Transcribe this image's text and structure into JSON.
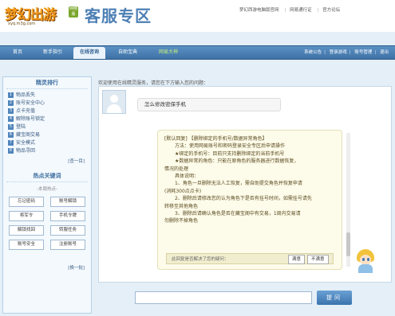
{
  "header": {
    "logo_text": "梦幻出游",
    "logo_tag": "网络版",
    "logo_url": "xyq.m3g.com",
    "title": "客服专区",
    "links": [
      "梦幻西游电脑版官网",
      "网易通行证",
      "官方论坛"
    ]
  },
  "nav": {
    "items": [
      {
        "label": "首页",
        "active": false
      },
      {
        "label": "新手指引",
        "active": false
      },
      {
        "label": "在线咨询",
        "active": true
      },
      {
        "label": "自助宝典",
        "active": false
      },
      {
        "label": "网易大神",
        "active": false
      }
    ],
    "right_links": [
      "系统公告",
      "登录游戏",
      "账号管理",
      "退出"
    ]
  },
  "sidebar": {
    "rank_title": "精灵排行",
    "rank_items": [
      "物品丢失",
      "账号安全中心",
      "点卡充值",
      "解除账号锁定",
      "登陆",
      "藏宝阁交易",
      "安全模式",
      "物品寻回"
    ],
    "rank_more": "[查一目]",
    "keyword_title": "热点关键词",
    "keyword_sub": "-本周热点-",
    "keywords": [
      "忘记密码",
      "账号解锁",
      "将军令",
      "手机令牌",
      "解锁找回",
      "转服任务",
      "账号安全",
      "注册账号"
    ],
    "keyword_more": "[换一批]"
  },
  "chat": {
    "hint": "欢迎使用在线精灵服务，请您在下方输入您的问题：",
    "question": "怎么修改密保手机",
    "answer": {
      "lines": [
        "[默认回复] 【删除绑定的手机号/数据异常角色】",
        "方法：使用网易账号和密码登录安全专区后申请操作",
        "★绑定的手机号：目前只支持删除绑定的当前手机号",
        "★数据异常的角色：只能在原角色的服务器进行数据恢复，",
        "情况的处理",
        "具体说明：",
        "1、角色一旦删除无法人工恢复，需自助提交角色并恢复申请",
        "(消耗300点点卡)",
        "2、删除后请修改您的认为角色下是否有挂号时间，如需挂号请先",
        "转移至其他角色",
        "3、删除后请确认角色是否在藏宝阁中有交易，1周内交易请",
        "勿删除不掉角色"
      ]
    },
    "rate": {
      "prompt": "此回复是否解决了您的疑问：",
      "yes": "满意",
      "no": "不满意"
    },
    "input_placeholder": "",
    "ask_button": "提问"
  },
  "colors": {
    "nav_blue": "#3f72a6",
    "title_blue": "#4c7fb4",
    "answer_bg": "#fdfbe9",
    "panel_bg": "#f3f9fd"
  }
}
